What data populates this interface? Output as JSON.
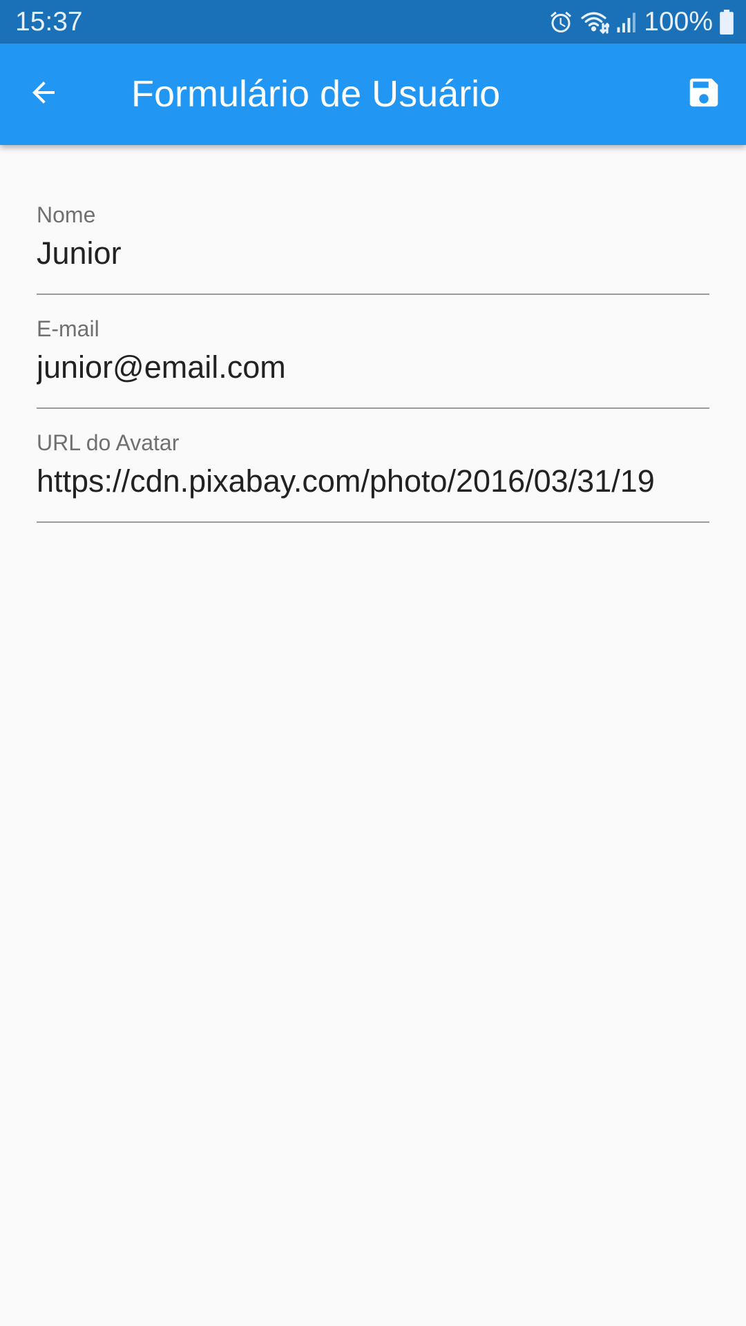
{
  "status_bar": {
    "time": "15:37",
    "battery_percent": "100%",
    "icons": [
      "alarm-icon",
      "wifi-icon",
      "signal-icon",
      "battery-icon"
    ],
    "background_color": "#1a71b8"
  },
  "app_bar": {
    "title": "Formulário de Usuário",
    "back_icon": "arrow-back-icon",
    "save_icon": "save-icon",
    "background_color": "#2196f3"
  },
  "form": {
    "fields": [
      {
        "label": "Nome",
        "value": "Junior"
      },
      {
        "label": "E-mail",
        "value": "junior@email.com"
      },
      {
        "label": "URL do Avatar",
        "value": "https://cdn.pixabay.com/photo/2016/03/31/19"
      }
    ]
  }
}
